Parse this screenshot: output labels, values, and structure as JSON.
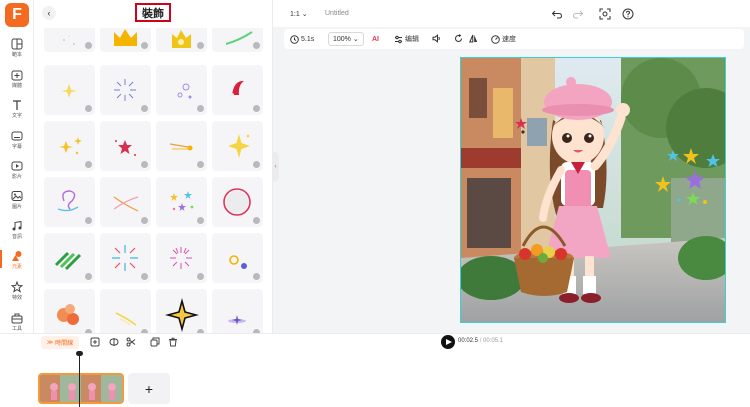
{
  "app": {
    "logo_text": "F",
    "brand_color": "#f36b21"
  },
  "sidebar": {
    "items": [
      {
        "label": "範本",
        "icon": "template-icon"
      },
      {
        "label": "媒體",
        "icon": "upload-icon"
      },
      {
        "label": "文字",
        "icon": "text-icon"
      },
      {
        "label": "字幕",
        "icon": "subtitle-icon"
      },
      {
        "label": "影片",
        "icon": "video-icon"
      },
      {
        "label": "圖片",
        "icon": "image-icon"
      },
      {
        "label": "音訊",
        "icon": "music-icon"
      },
      {
        "label": "元素",
        "icon": "elements-icon",
        "active": true
      },
      {
        "label": "特效",
        "icon": "effects-icon"
      },
      {
        "label": "工具",
        "icon": "toolbox-icon"
      }
    ]
  },
  "panel": {
    "back_label": "‹",
    "title": "裝飾"
  },
  "topbar": {
    "ratio": "1:1",
    "project_title": "Untitled"
  },
  "toolbar": {
    "duration": "5.1s",
    "zoom": "100%",
    "edit_label": "编辑",
    "speed_label": "速度",
    "ai_label": "AI"
  },
  "timeline": {
    "label": "時間線",
    "current": "00:02.5",
    "separator": "/",
    "total": "00:05.1",
    "add_label": "+"
  },
  "colors": {
    "accent": "#f36b21",
    "selection": "#3ad1d6",
    "clip_border": "#f39a3d"
  }
}
